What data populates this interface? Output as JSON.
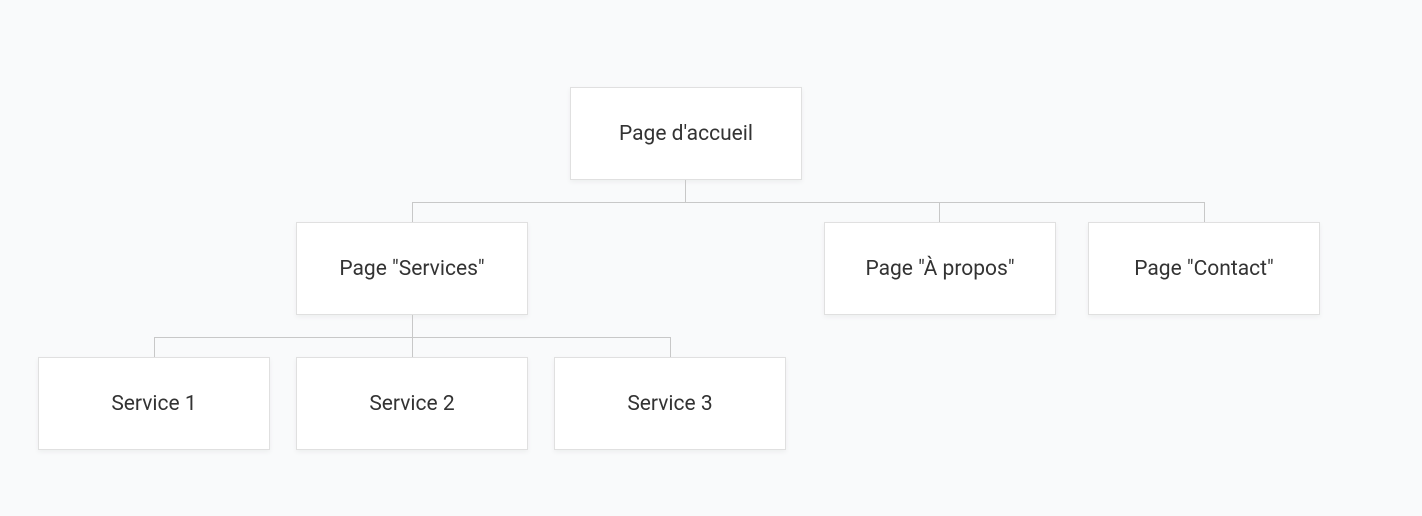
{
  "root": {
    "label": "Page d'accueil"
  },
  "level1": {
    "services": {
      "label": "Page \"Services\""
    },
    "about": {
      "label": "Page \"À propos\""
    },
    "contact": {
      "label": "Page \"Contact\""
    }
  },
  "level2": {
    "service1": {
      "label": "Service 1"
    },
    "service2": {
      "label": "Service 2"
    },
    "service3": {
      "label": "Service 3"
    }
  }
}
